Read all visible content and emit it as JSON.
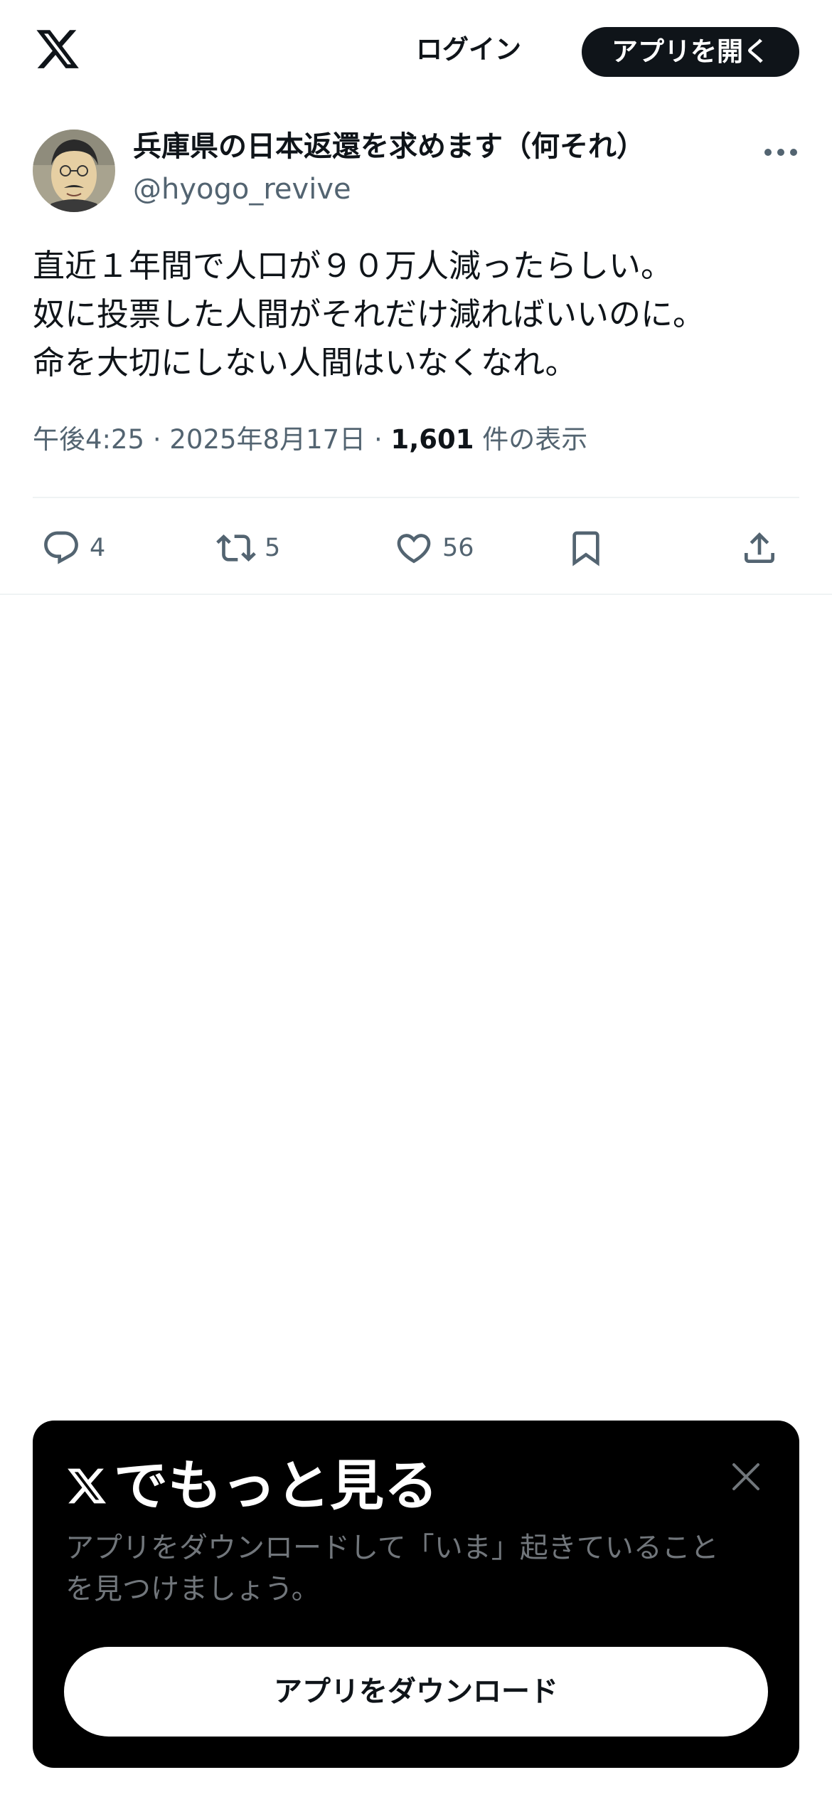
{
  "header": {
    "logo_icon": "x-logo-icon",
    "login_label": "ログイン",
    "open_app_label": "アプリを開く"
  },
  "post": {
    "author": {
      "display_name": "兵庫県の日本返還を求めます（何それ）",
      "handle": "@hyogo_revive",
      "avatar_icon": "avatar-illustration"
    },
    "more_icon": "more-horizontal-icon",
    "text_lines": [
      "直近１年間で人口が９０万人減ったらしい。",
      "奴に投票した人間がそれだけ減ればいいのに。",
      "命を大切にしない人間はいなくなれ。"
    ],
    "time": "午後4:25",
    "separator": "·",
    "date": "2025年8月17日",
    "views_count": "1,601",
    "views_label": "件の表示"
  },
  "actions": {
    "replies": {
      "icon": "reply-icon",
      "count": "4"
    },
    "reposts": {
      "icon": "repost-icon",
      "count": "5"
    },
    "likes": {
      "icon": "heart-icon",
      "count": "56"
    },
    "bookmark": {
      "icon": "bookmark-icon"
    },
    "share": {
      "icon": "share-icon"
    }
  },
  "promo": {
    "title": "でもっと見る",
    "description_line1": "アプリをダウンロードして「いま」起きていること",
    "description_line2": "を見つけましょう。",
    "download_label": "アプリをダウンロード",
    "close_icon": "close-icon"
  },
  "colors": {
    "text_primary": "#0f1419",
    "text_secondary": "#536471",
    "promo_background": "#000000",
    "promo_text_secondary": "#71767b",
    "divider": "#eff3f4"
  }
}
